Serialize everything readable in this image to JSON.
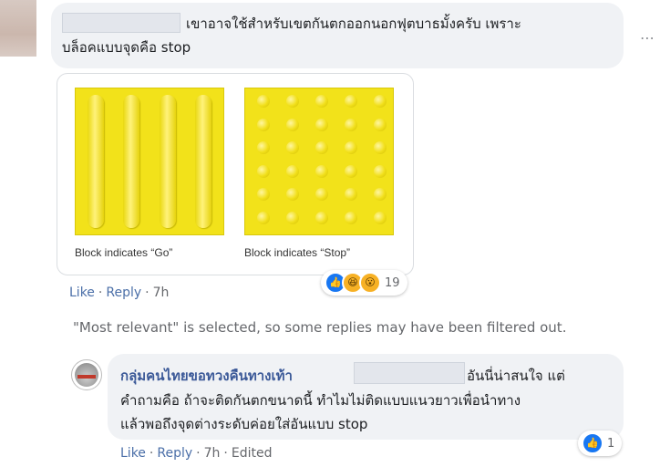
{
  "comment1": {
    "text_line1": "เขาอาจใช้สำหรับเขตกันตกออกนอกฟุตบาธมั้งครับ เพราะ",
    "text_line2": "บล็อคแบบจุดคือ stop",
    "image": {
      "caption_go": "Block indicates “Go”",
      "caption_stop": "Block indicates “Stop”",
      "tile_color": "#f2e21a"
    },
    "actions": {
      "like": "Like",
      "reply": "Reply",
      "time": "7h"
    },
    "reactions": {
      "icons": [
        "like-icon",
        "haha-icon",
        "wow-icon"
      ],
      "count": "19"
    }
  },
  "filter_note": "\"Most relevant\" is selected, so some replies may have been filtered out.",
  "reply1": {
    "author": "กลุ่มคนไทยขอทวงคืนทางเท้า",
    "text_after_name": "อันนี่น่าสนใจ แต่",
    "text_line2": "คำถามคือ ถ้าจะติดกันตกขนาดนี้ ทำไมไม่ติดแบบแนวยาวเพื่อนำทาง",
    "text_line3": "แล้วพอถึงจุดต่างระดับค่อยใส่อันแบบ stop",
    "actions": {
      "like": "Like",
      "reply": "Reply",
      "time": "7h",
      "edited": "Edited"
    },
    "reactions": {
      "icons": [
        "like-icon"
      ],
      "count": "1"
    }
  },
  "colors": {
    "bubble": "#f0f2f5",
    "link": "#4b6fa8",
    "author": "#3b5998",
    "like_blue": "#1877f2"
  }
}
